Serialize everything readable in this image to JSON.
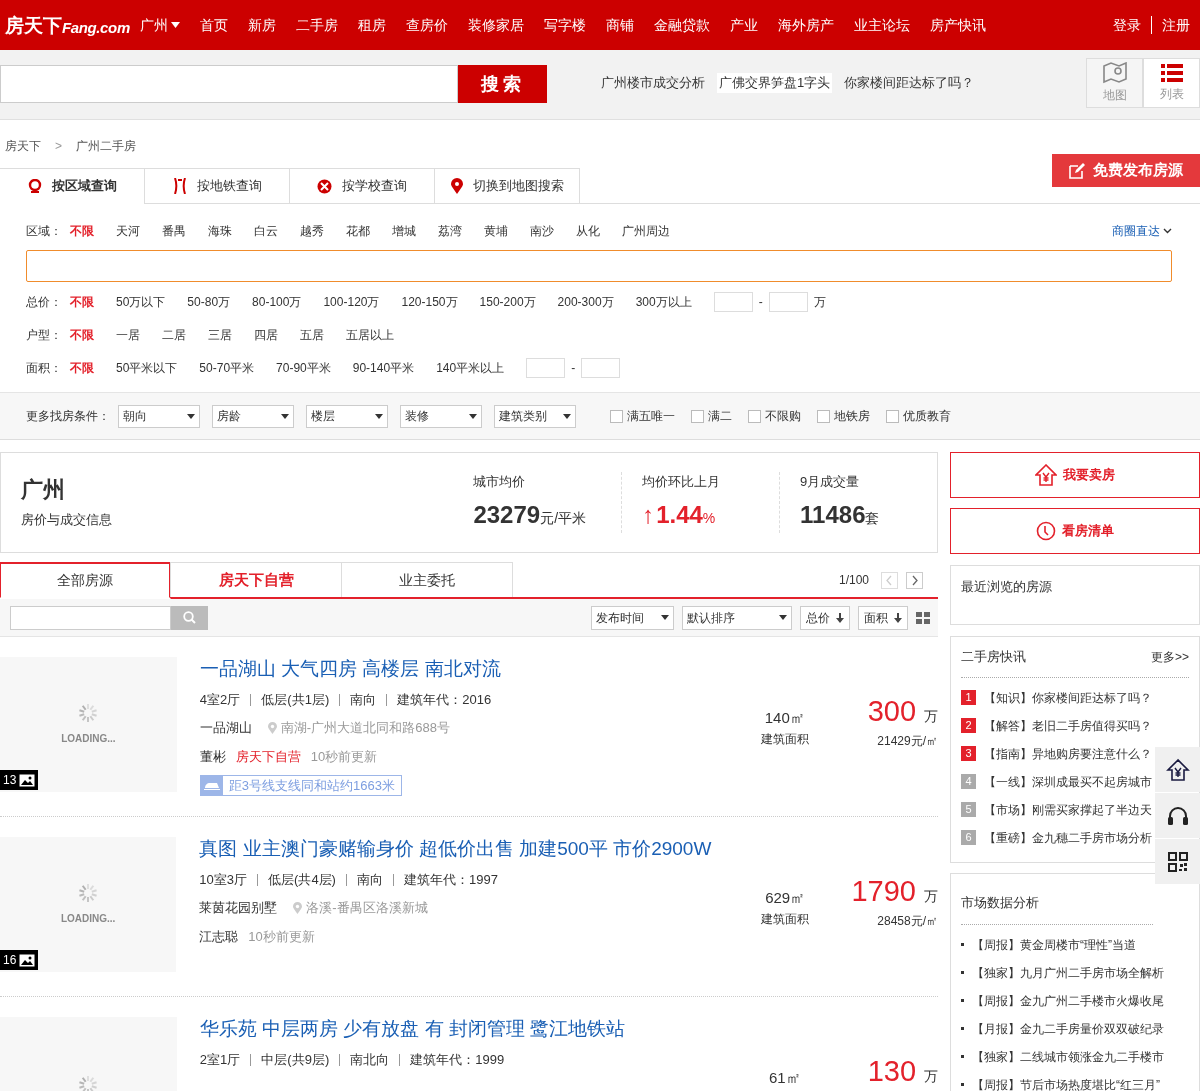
{
  "nav": {
    "logo": "房天下",
    "logo_sub": "Fang.com",
    "city": "广州",
    "links": [
      "首页",
      "新房",
      "二手房",
      "租房",
      "查房价",
      "装修家居",
      "写字楼",
      "商铺",
      "金融贷款",
      "产业",
      "海外房产",
      "业主论坛",
      "房产快讯"
    ],
    "auth": [
      "登录",
      "注册"
    ]
  },
  "search": {
    "button": "搜索",
    "hot_links": [
      {
        "label": "广州楼市成交分析",
        "highlighted": false
      },
      {
        "label": "广佛交界笋盘1字头",
        "highlighted": true
      },
      {
        "label": "你家楼间距达标了吗？",
        "highlighted": false
      }
    ],
    "views": [
      {
        "label": "地图",
        "kind": "map",
        "selected": false
      },
      {
        "label": "列表",
        "kind": "list",
        "selected": true
      }
    ]
  },
  "breadcrumb": [
    "房天下",
    ">",
    "广州二手房"
  ],
  "publish_button": "免费发布房源",
  "query_tabs": [
    {
      "label": "按区域查询",
      "kind": "area",
      "selected": true
    },
    {
      "label": "按地铁查询",
      "kind": "subway",
      "selected": false
    },
    {
      "label": "按学校查询",
      "kind": "school",
      "selected": false
    },
    {
      "label": "切换到地图搜索",
      "kind": "map",
      "selected": false
    }
  ],
  "filters": [
    {
      "label": "区域：",
      "options": [
        {
          "label": "不限",
          "selected": true
        },
        {
          "label": "天河",
          "selected": false
        },
        {
          "label": "番禺",
          "selected": false
        },
        {
          "label": "海珠",
          "selected": false
        },
        {
          "label": "白云",
          "selected": false
        },
        {
          "label": "越秀",
          "selected": false
        },
        {
          "label": "花都",
          "selected": false
        },
        {
          "label": "增城",
          "selected": false
        },
        {
          "label": "荔湾",
          "selected": false
        },
        {
          "label": "黄埔",
          "selected": false
        },
        {
          "label": "南沙",
          "selected": false
        },
        {
          "label": "从化",
          "selected": false
        },
        {
          "label": "广州周边",
          "selected": false
        }
      ],
      "link": "商圈直达"
    },
    {
      "label": "总价：",
      "options": [
        {
          "label": "不限",
          "selected": true
        },
        {
          "label": "50万以下",
          "selected": false
        },
        {
          "label": "50-80万",
          "selected": false
        },
        {
          "label": "80-100万",
          "selected": false
        },
        {
          "label": "100-120万",
          "selected": false
        },
        {
          "label": "120-150万",
          "selected": false
        },
        {
          "label": "150-200万",
          "selected": false
        },
        {
          "label": "200-300万",
          "selected": false
        },
        {
          "label": "300万以上",
          "selected": false
        }
      ],
      "range": {
        "separator": "-",
        "unit": "万"
      }
    },
    {
      "label": "户型：",
      "options": [
        {
          "label": "不限",
          "selected": true
        },
        {
          "label": "一居",
          "selected": false
        },
        {
          "label": "二居",
          "selected": false
        },
        {
          "label": "三居",
          "selected": false
        },
        {
          "label": "四居",
          "selected": false
        },
        {
          "label": "五居",
          "selected": false
        },
        {
          "label": "五居以上",
          "selected": false
        }
      ]
    },
    {
      "label": "面积：",
      "options": [
        {
          "label": "不限",
          "selected": true
        },
        {
          "label": "50平米以下",
          "selected": false
        },
        {
          "label": "50-70平米",
          "selected": false
        },
        {
          "label": "70-90平米",
          "selected": false
        },
        {
          "label": "90-140平米",
          "selected": false
        },
        {
          "label": "140平米以上",
          "selected": false
        }
      ],
      "range": {
        "separator": "-"
      }
    }
  ],
  "more_conditions": {
    "label": "更多找房条件：",
    "dropdowns": [
      "朝向",
      "房龄",
      "楼层",
      "装修",
      "建筑类别"
    ],
    "checkboxes": [
      {
        "label": "满五唯一",
        "checked": false
      },
      {
        "label": "满二",
        "checked": false
      },
      {
        "label": "不限购",
        "checked": false
      },
      {
        "label": "地铁房",
        "checked": false
      },
      {
        "label": "优质教育",
        "checked": false
      }
    ]
  },
  "stats": {
    "city": "广州",
    "subtitle": "房价与成交信息",
    "metrics": [
      {
        "label": "城市均价",
        "value": "23279",
        "unit": "元/平米",
        "kind": "plain"
      },
      {
        "label": "均价环比上月",
        "arrow": "↑",
        "value": "1.44",
        "unit": "%",
        "kind": "change"
      },
      {
        "label": "9月成交量",
        "value": "11486",
        "unit": "套",
        "kind": "plain"
      }
    ]
  },
  "side_buttons": [
    {
      "label": "我要卖房",
      "kind": "sell"
    },
    {
      "label": "看房清单",
      "kind": "list"
    }
  ],
  "list_tabs": [
    {
      "label": "全部房源",
      "kind": "plain",
      "selected": true
    },
    {
      "label": "房天下自营",
      "kind": "brand",
      "selected": false
    },
    {
      "label": "业主委托",
      "kind": "plain",
      "selected": false
    }
  ],
  "pagination": "1/100",
  "sort_bar": {
    "dropdowns": [
      "发布时间",
      "默认排序"
    ],
    "sort_buttons": [
      "总价",
      "面积"
    ]
  },
  "listings": [
    {
      "title": "一品湖山 大气四房 高楼层 南北对流",
      "specs": [
        "4室2厅",
        "低层(共1层)",
        "南向",
        "建筑年代：2016"
      ],
      "community": "一品湖山",
      "location": "南湖-广州大道北同和路688号",
      "agent": "董彬",
      "tag": "房天下自营",
      "updated": "10秒前更新",
      "subway": "距3号线支线同和站约1663米",
      "area": "140㎡",
      "area_label": "建筑面积",
      "price": "300",
      "price_unit": "万",
      "unit_price": "21429元/㎡",
      "photo_count": "13",
      "loading": "LOADING..."
    },
    {
      "title": "真图 业主澳门豪赌输身价 超低价出售 加建500平 市价2900W",
      "specs": [
        "10室3厅",
        "低层(共4层)",
        "南向",
        "建筑年代：1997"
      ],
      "community": "莱茵花园别墅",
      "location": "洛溪-番禺区洛溪新城",
      "agent": "江志聪",
      "updated": "10秒前更新",
      "area": "629㎡",
      "area_label": "建筑面积",
      "price": "1790",
      "price_unit": "万",
      "unit_price": "28458元/㎡",
      "photo_count": "16",
      "loading": "LOADING..."
    },
    {
      "title": "华乐苑 中层两房 少有放盘 有 封闭管理 鹭江地铁站",
      "specs": [
        "2室1厅",
        "中层(共9层)",
        "南北向",
        "建筑年代：1999"
      ],
      "area": "61㎡",
      "price": "130",
      "price_unit": "万"
    }
  ],
  "recent": {
    "title": "最近浏览的房源"
  },
  "news": {
    "title": "二手房快讯",
    "more": "更多>>",
    "items": [
      {
        "num": "1",
        "hot": true,
        "text": "【知识】你家楼间距达标了吗？"
      },
      {
        "num": "2",
        "hot": true,
        "text": "【解答】老旧二手房值得买吗？"
      },
      {
        "num": "3",
        "hot": true,
        "text": "【指南】异地购房要注意什么？"
      },
      {
        "num": "4",
        "hot": false,
        "text": "【一线】深圳成最买不起房城市"
      },
      {
        "num": "5",
        "hot": false,
        "text": "【市场】刚需买家撑起了半边天"
      },
      {
        "num": "6",
        "hot": false,
        "text": "【重磅】金九穗二手房市场分析"
      }
    ]
  },
  "market": {
    "title": "市场数据分析",
    "items": [
      "【周报】黄金周楼市“理性”当道",
      "【独家】九月广州二手房市场全解析",
      "【周报】金九广州二手楼市火爆收尾",
      "【月报】金九二手房量价双双破纪录",
      "【独家】二线城市领涨金九二手楼市",
      "【周报】节后市场热度堪比“红三月”"
    ]
  },
  "float_tools": [
    {
      "kind": "sell"
    },
    {
      "kind": "service"
    },
    {
      "kind": "qr"
    }
  ]
}
